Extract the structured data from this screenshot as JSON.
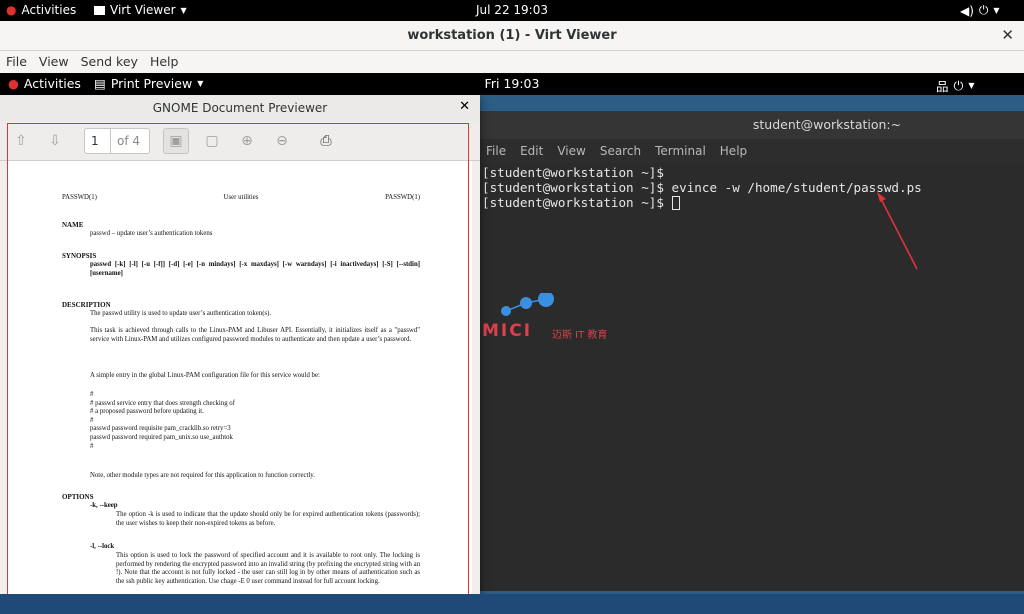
{
  "host": {
    "activities": "Activities",
    "app_menu": "Virt Viewer",
    "clock": "Jul 22  19:03",
    "window_title": "workstation (1) - Virt Viewer",
    "menu": [
      "File",
      "View",
      "Send key",
      "Help"
    ]
  },
  "guest": {
    "activities": "Activities",
    "app_menu": "Print Preview",
    "clock": "Fri 19:03"
  },
  "previewer": {
    "title": "GNOME Document Previewer",
    "page_number": "1",
    "page_count": "of 4",
    "doc": {
      "head_left": "PASSWD(1)",
      "head_center": "User utilities",
      "head_right": "PASSWD(1)",
      "name_heading": "NAME",
      "name_text": "passwd – update user’s authentication tokens",
      "synopsis_heading": "SYNOPSIS",
      "synopsis_text": "passwd [-k] [-l] [-u [-f]] [-d] [-e] [-n mindays] [-x maxdays] [-w warndays] [-i inactivedays] [-S] [--stdin] [username]",
      "description_heading": "DESCRIPTION",
      "desc_1": "The passwd utility is used to update user’s authentication token(s).",
      "desc_2": "This task is achieved through calls to the Linux-PAM and Libuser API. Essentially, it initializes itself as a \"passwd\" service with Linux-PAM and utilizes configured password modules to authenticate and then update a user’s password.",
      "desc_3": "A simple entry in the global Linux-PAM configuration file for this service would be:",
      "code": [
        "#",
        "# passwd service entry that does strength checking of",
        "# a proposed password before updating it.",
        "#",
        "passwd password requisite pam_cracklib.so retry=3",
        "passwd password required pam_unix.so use_authtok",
        "#"
      ],
      "desc_4": "Note, other module types are not required for this application to function correctly.",
      "options_heading": "OPTIONS",
      "opt_k": "-k, --keep",
      "opt_k_text": "The option -k is used to indicate that the update should only be for expired authentication tokens (passwords); the user wishes to keep their non-expired tokens as before.",
      "opt_l": "-l, --lock",
      "opt_l_text": "This option is used to lock the password of specified account and it is available to root only. The locking is performed by rendering the encrypted password into an invalid string (by prefixing the encrypted string with an !). Note that the account is not fully locked - the user can still log in by other means of authentication such as the ssh public key authentication. Use chage -E 0 user command instead for full account locking."
    }
  },
  "terminal": {
    "title": "student@workstation:~",
    "menu": [
      "File",
      "Edit",
      "View",
      "Search",
      "Terminal",
      "Help"
    ],
    "lines": [
      "[student@workstation ~]$",
      "[student@workstation ~]$ evince -w /home/student/passwd.ps",
      "[student@workstation ~]$ "
    ]
  },
  "watermark": {
    "brand": "MICI",
    "subtitle": "迈斯 IT 教育"
  },
  "colors": {
    "annotation": "#e0333a",
    "desktop": "#2c5d87"
  }
}
